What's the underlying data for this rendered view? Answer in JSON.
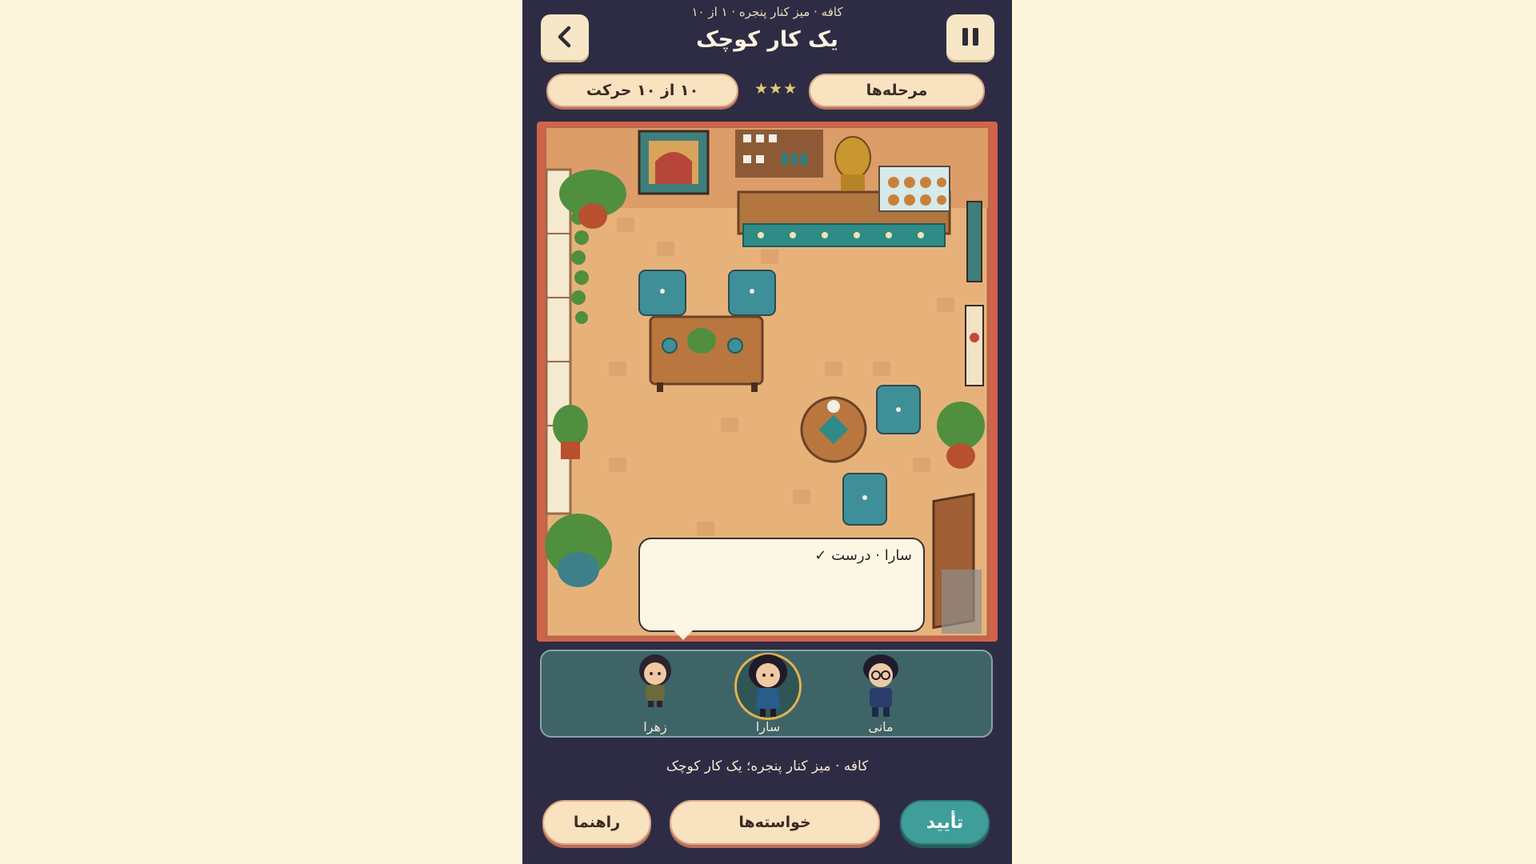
{
  "header": {
    "breadcrumb": "کافه · میز کنار پنجره · ۱ از ۱۰",
    "title": "یک کار کوچک"
  },
  "status": {
    "moves_label": "۱۰ از ۱۰ حرکت",
    "stars": "★★★",
    "stages_label": "مرحله‌ها"
  },
  "scene": {
    "speech": "سارا · درست ✓"
  },
  "characters": [
    {
      "name": "زهرا",
      "selected": false
    },
    {
      "name": "سارا",
      "selected": true
    },
    {
      "name": "مانی",
      "selected": false
    }
  ],
  "caption": "کافه · میز کنار پنجره؛ یک کار کوچک",
  "buttons": {
    "guide": "راهنما",
    "wishes": "خواسته‌ها",
    "confirm": "تأیید"
  },
  "icons": {
    "back": "chevron-left-icon",
    "pause": "pause-icon"
  },
  "colors": {
    "panel": "#2e2c44",
    "accent_teal": "#3f9e9a",
    "cream": "#f8e2c0",
    "frame_red": "#d0644b"
  }
}
